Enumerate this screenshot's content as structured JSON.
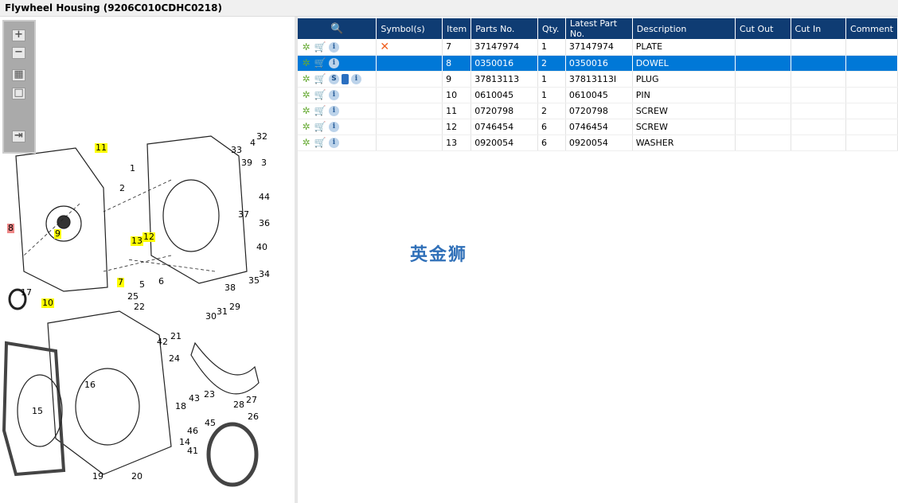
{
  "title": "Flywheel Housing (9206C010CDHC0218)",
  "toolbar": {
    "zoom_in": "+",
    "zoom_out": "−",
    "fit": "▦",
    "actual": "□",
    "export": "⇥"
  },
  "callouts": [
    {
      "n": "11",
      "hl": "y"
    },
    {
      "n": "1"
    },
    {
      "n": "2"
    },
    {
      "n": "8",
      "hl": "r"
    },
    {
      "n": "9",
      "hl": "y"
    },
    {
      "n": "13",
      "hl": "y"
    },
    {
      "n": "12",
      "hl": "y"
    },
    {
      "n": "7",
      "hl": "y"
    },
    {
      "n": "5"
    },
    {
      "n": "6"
    },
    {
      "n": "38"
    },
    {
      "n": "35"
    },
    {
      "n": "34"
    },
    {
      "n": "40"
    },
    {
      "n": "36"
    },
    {
      "n": "37"
    },
    {
      "n": "44"
    },
    {
      "n": "3"
    },
    {
      "n": "39"
    },
    {
      "n": "4"
    },
    {
      "n": "32"
    },
    {
      "n": "33"
    },
    {
      "n": "10",
      "hl": "y"
    },
    {
      "n": "25"
    },
    {
      "n": "17"
    },
    {
      "n": "22"
    },
    {
      "n": "21"
    },
    {
      "n": "42"
    },
    {
      "n": "29"
    },
    {
      "n": "31"
    },
    {
      "n": "30"
    },
    {
      "n": "24"
    },
    {
      "n": "23"
    },
    {
      "n": "43"
    },
    {
      "n": "18"
    },
    {
      "n": "16"
    },
    {
      "n": "15"
    },
    {
      "n": "14"
    },
    {
      "n": "28"
    },
    {
      "n": "27"
    },
    {
      "n": "26"
    },
    {
      "n": "45"
    },
    {
      "n": "46"
    },
    {
      "n": "41"
    },
    {
      "n": "19"
    },
    {
      "n": "20"
    }
  ],
  "table": {
    "headers": [
      "",
      "Symbol(s)",
      "Item",
      "Parts No.",
      "Qty.",
      "Latest Part No.",
      "Description",
      "Cut Out",
      "Cut In",
      "Comment"
    ],
    "rows": [
      {
        "icons": [
          "gear",
          "cart",
          "info"
        ],
        "symbol": "✕",
        "item": "7",
        "part": "37147974",
        "qty": "1",
        "latest": "37147974",
        "desc": "PLATE"
      },
      {
        "icons": [
          "gear",
          "cart",
          "info"
        ],
        "symbol": "",
        "item": "8",
        "part": "0350016",
        "qty": "2",
        "latest": "0350016",
        "desc": "DOWEL",
        "selected": true
      },
      {
        "icons": [
          "gear",
          "cart",
          "s",
          "book",
          "info"
        ],
        "symbol": "",
        "item": "9",
        "part": "37813113",
        "qty": "1",
        "latest": "37813113I",
        "desc": "PLUG"
      },
      {
        "icons": [
          "gear",
          "cart",
          "info"
        ],
        "symbol": "",
        "item": "10",
        "part": "0610045",
        "qty": "1",
        "latest": "0610045",
        "desc": "PIN"
      },
      {
        "icons": [
          "gear",
          "cart",
          "info"
        ],
        "symbol": "",
        "item": "11",
        "part": "0720798",
        "qty": "2",
        "latest": "0720798",
        "desc": "SCREW"
      },
      {
        "icons": [
          "gear",
          "cart",
          "info"
        ],
        "symbol": "",
        "item": "12",
        "part": "0746454",
        "qty": "6",
        "latest": "0746454",
        "desc": "SCREW"
      },
      {
        "icons": [
          "gear",
          "cart",
          "info"
        ],
        "symbol": "",
        "item": "13",
        "part": "0920054",
        "qty": "6",
        "latest": "0920054",
        "desc": "WASHER"
      }
    ]
  },
  "watermark": "英金狮"
}
